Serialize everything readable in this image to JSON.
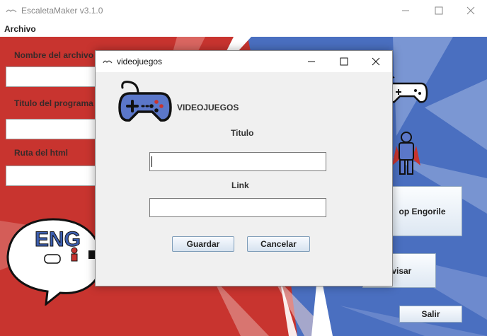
{
  "window": {
    "title": "EscaletaMaker v3.1.0"
  },
  "menu": {
    "items": [
      "Archivo"
    ]
  },
  "main_form": {
    "file_name_label": "Nombre  del archivo",
    "program_title_label": "Titulo del programa",
    "html_path_label": "Ruta del html",
    "file_name_value": "",
    "program_title_value": "",
    "html_path_value": ""
  },
  "right_panel": {
    "engorile_button": "op Engorile",
    "review_button": "evisar",
    "exit_button": "Salir"
  },
  "logo": {
    "partial_text": "ENG"
  },
  "dialog": {
    "title": "videojuegos",
    "heading": "VIDEOJUEGOS",
    "title_label": "Titulo",
    "title_value": "",
    "link_label": "Link",
    "link_value": "",
    "save_button": "Guardar",
    "cancel_button": "Cancelar"
  },
  "colors": {
    "background_red": "#c8342f",
    "background_blue": "#4a6fc0",
    "gamepad_blue": "#5b77c9"
  }
}
